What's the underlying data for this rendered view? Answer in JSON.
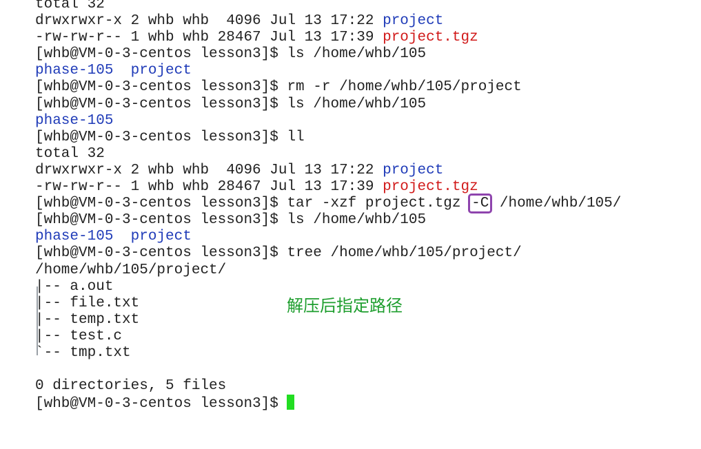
{
  "terminal": {
    "lines": [
      {
        "segments": [
          {
            "text": "total 32",
            "style": "plain"
          }
        ]
      },
      {
        "segments": [
          {
            "text": "drwxrwxr-x 2 whb whb  4096 Jul 13 17:22 ",
            "style": "plain"
          },
          {
            "text": "project",
            "style": "dir"
          }
        ]
      },
      {
        "segments": [
          {
            "text": "-rw-rw-r-- 1 whb whb 28467 Jul 13 17:39 ",
            "style": "plain"
          },
          {
            "text": "project.tgz",
            "style": "arch"
          }
        ]
      },
      {
        "segments": [
          {
            "text": "[whb@VM-0-3-centos lesson3]$ ls /home/whb/105",
            "style": "plain"
          }
        ]
      },
      {
        "segments": [
          {
            "text": "phase-105",
            "style": "dir"
          },
          {
            "text": "  ",
            "style": "plain"
          },
          {
            "text": "project",
            "style": "dir"
          }
        ]
      },
      {
        "segments": [
          {
            "text": "[whb@VM-0-3-centos lesson3]$ rm -r /home/whb/105/project",
            "style": "plain"
          }
        ]
      },
      {
        "segments": [
          {
            "text": "[whb@VM-0-3-centos lesson3]$ ls /home/whb/105",
            "style": "plain"
          }
        ]
      },
      {
        "segments": [
          {
            "text": "phase-105",
            "style": "dir"
          }
        ]
      },
      {
        "segments": [
          {
            "text": "[whb@VM-0-3-centos lesson3]$ ll",
            "style": "plain"
          }
        ]
      },
      {
        "segments": [
          {
            "text": "total 32",
            "style": "plain"
          }
        ]
      },
      {
        "segments": [
          {
            "text": "drwxrwxr-x 2 whb whb  4096 Jul 13 17:22 ",
            "style": "plain"
          },
          {
            "text": "project",
            "style": "dir"
          }
        ]
      },
      {
        "segments": [
          {
            "text": "-rw-rw-r-- 1 whb whb 28467 Jul 13 17:39 ",
            "style": "plain"
          },
          {
            "text": "project.tgz",
            "style": "arch"
          }
        ]
      },
      {
        "segments": [
          {
            "text": "[whb@VM-0-3-centos lesson3]$ tar -xzf project.tgz ",
            "style": "plain"
          },
          {
            "text": "-C",
            "style": "highlight"
          },
          {
            "text": " /home/whb/105/",
            "style": "plain"
          }
        ]
      },
      {
        "segments": [
          {
            "text": "[whb@VM-0-3-centos lesson3]$ ls /home/whb/105",
            "style": "plain"
          }
        ]
      },
      {
        "segments": [
          {
            "text": "phase-105",
            "style": "dir"
          },
          {
            "text": "  ",
            "style": "plain"
          },
          {
            "text": "project",
            "style": "dir"
          }
        ]
      },
      {
        "segments": [
          {
            "text": "[whb@VM-0-3-centos lesson3]$ tree /home/whb/105/project/",
            "style": "plain"
          }
        ]
      },
      {
        "segments": [
          {
            "text": "/home/whb/105/project/",
            "style": "plain"
          }
        ]
      },
      {
        "segments": [
          {
            "text": "|-- a.out",
            "style": "plain"
          }
        ]
      },
      {
        "segments": [
          {
            "text": "|-- file.txt",
            "style": "plain"
          }
        ]
      },
      {
        "segments": [
          {
            "text": "|-- temp.txt",
            "style": "plain"
          }
        ]
      },
      {
        "segments": [
          {
            "text": "|-- test.c",
            "style": "plain"
          }
        ]
      },
      {
        "segments": [
          {
            "text": "`-- tmp.txt",
            "style": "plain"
          }
        ]
      },
      {
        "segments": [
          {
            "text": "",
            "style": "plain"
          }
        ]
      },
      {
        "segments": [
          {
            "text": "0 directories, 5 files",
            "style": "plain"
          }
        ]
      },
      {
        "segments": [
          {
            "text": "[whb@VM-0-3-centos lesson3]$ ",
            "style": "plain"
          },
          {
            "text": "",
            "style": "cursor"
          }
        ]
      }
    ]
  },
  "annotation": {
    "text": "解压后指定路径",
    "color": "#1e9e2e"
  },
  "colors": {
    "directory": "#1f3bb8",
    "archive": "#d11a1a",
    "highlight_box": "#8e44ad",
    "cursor": "#22dd22",
    "text": "#222222"
  }
}
